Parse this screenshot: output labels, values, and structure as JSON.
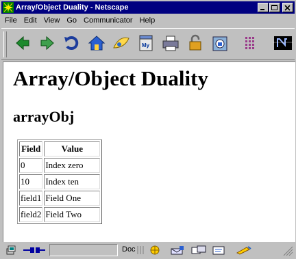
{
  "window": {
    "title": "Array/Object Duality - Netscape"
  },
  "menu": [
    "File",
    "Edit",
    "View",
    "Go",
    "Communicator",
    "Help"
  ],
  "toolbar": {
    "buttons": [
      "back",
      "forward",
      "reload",
      "home",
      "search",
      "my-netscape",
      "print",
      "security",
      "shop",
      "stop",
      "netscape-logo"
    ]
  },
  "page": {
    "heading": "Array/Object Duality",
    "subheading": "arrayObj",
    "table": {
      "headers": [
        "Field",
        "Value"
      ],
      "rows": [
        [
          "0",
          "Index zero"
        ],
        [
          "10",
          "Index ten"
        ],
        [
          "field1",
          "Field One"
        ],
        [
          "field2",
          "Field Two"
        ]
      ]
    }
  },
  "status": {
    "doc_label": "Doc"
  }
}
